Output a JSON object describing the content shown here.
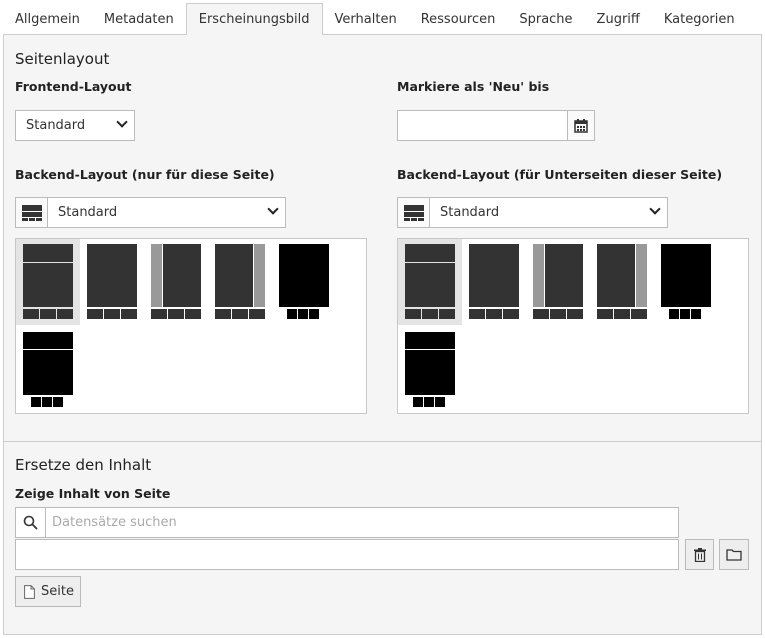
{
  "tabs": [
    {
      "label": "Allgemein"
    },
    {
      "label": "Metadaten"
    },
    {
      "label": "Erscheinungsbild"
    },
    {
      "label": "Verhalten"
    },
    {
      "label": "Ressourcen"
    },
    {
      "label": "Sprache"
    },
    {
      "label": "Zugriff"
    },
    {
      "label": "Kategorien"
    }
  ],
  "active_tab": "Erscheinungsbild",
  "page_layout": {
    "title": "Seitenlayout",
    "frontend_layout": {
      "label": "Frontend-Layout",
      "value": "Standard"
    },
    "mark_new_until": {
      "label": "Markiere als 'Neu' bis",
      "value": ""
    },
    "backend_layout_page": {
      "label": "Backend-Layout (nur für diese Seite)",
      "value": "Standard"
    },
    "backend_layout_subpages": {
      "label": "Backend-Layout (für Unterseiten dieser Seite)",
      "value": "Standard"
    },
    "layout_thumbnails": [
      "standard",
      "columns-main",
      "left-sidebar",
      "right-sidebar",
      "black-full",
      "black-header"
    ]
  },
  "replace_content": {
    "title": "Ersetze den Inhalt",
    "show_content_label": "Zeige Inhalt von Seite",
    "search_placeholder": "Datensätze suchen",
    "selected_value": "",
    "page_button_label": "Seite"
  },
  "colors": {
    "panel_bg": "#f5f5f5",
    "border": "#cdcdcd",
    "thumb_dark": "#333333",
    "thumb_black": "#000000",
    "thumb_gray": "#999999"
  }
}
